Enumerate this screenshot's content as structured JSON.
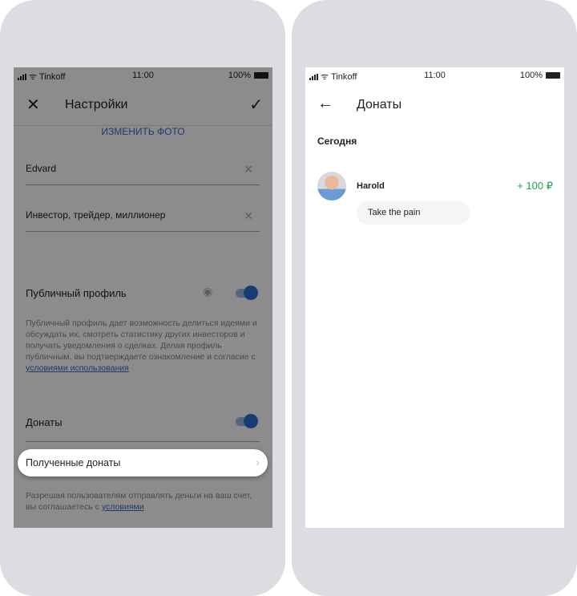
{
  "status": {
    "carrier": "Tinkoff",
    "time": "11:00",
    "battery": "100%"
  },
  "settings": {
    "title": "Настройки",
    "change_photo": "ИЗМЕНИТЬ ФОТО",
    "name_value": "Edvard",
    "bio_value": "Инвестор, трейдер, миллионер",
    "public_label": "Публичный профиль",
    "public_on": true,
    "public_desc": "Публичный профиль дает возможность делиться идеями и обсуждать их, смотреть статистику других инвесторов и получать уведомления о сделках. Делая профиль публичным, вы подтверждаете ознакомление и согласие с ",
    "public_link": "условиями использования",
    "donations_label": "Донаты",
    "donations_on": true,
    "received_label": "Полученные донаты",
    "footer_text": "Разрешая пользователям отправлять деньги на ваш счет, вы соглашаетесь с ",
    "footer_link": "условиями"
  },
  "donations": {
    "title": "Донаты",
    "section": "Сегодня",
    "items": [
      {
        "name": "Harold",
        "amount": "+ 100 ₽",
        "message": "Take the pain"
      }
    ]
  },
  "colors": {
    "accent": "#2f6fd0",
    "positive": "#1aa34a"
  }
}
